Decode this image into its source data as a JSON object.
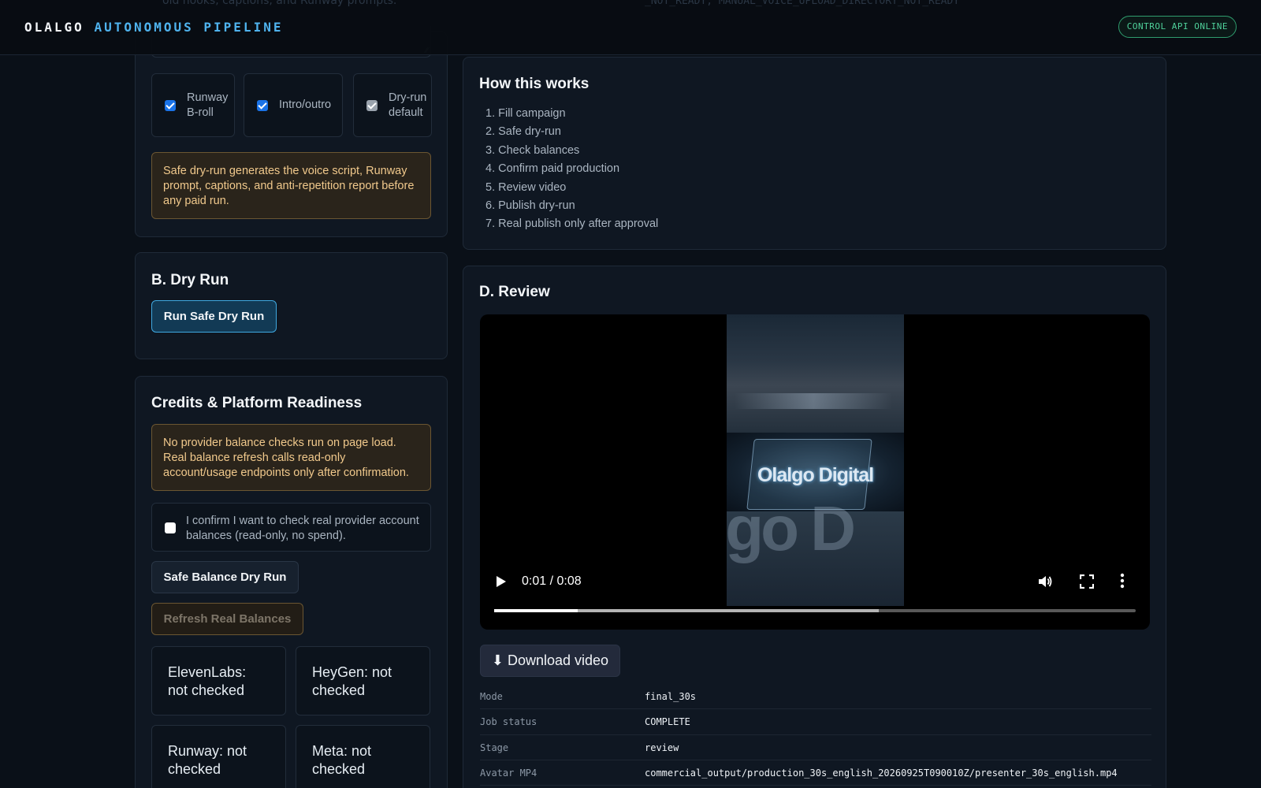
{
  "header": {
    "brand_main": "OLALGO",
    "brand_accent": "AUTONOMOUS PIPELINE",
    "api_status": "CONTROL API ONLINE",
    "bg_text_left": "old hooks, captions, and Runway prompts.",
    "bg_text_right": "_NOT_READY, MANUAL_VOICE_UPLOAD_DIRECTORY_NOT_READY"
  },
  "options": {
    "runway_broll": "Runway B-roll",
    "intro_outro": "Intro/outro",
    "dry_run_default": "Dry-run default",
    "notice": "Safe dry-run generates the voice script, Runway prompt, captions, and anti-repetition report before any paid run."
  },
  "dry_run": {
    "title": "B. Dry Run",
    "button": "Run Safe Dry Run"
  },
  "credits": {
    "title": "Credits & Platform Readiness",
    "notice": "No provider balance checks run on page load. Real balance refresh calls read-only account/usage endpoints only after confirmation.",
    "confirm_label": "I confirm I want to check real provider account balances (read-only, no spend).",
    "safe_button": "Safe Balance Dry Run",
    "refresh_button": "Refresh Real Balances",
    "providers": {
      "elevenlabs": "ElevenLabs: not checked",
      "heygen": "HeyGen: not checked",
      "runway": "Runway: not checked",
      "meta": "Meta: not checked"
    }
  },
  "how": {
    "title": "How this works",
    "steps": [
      "1. Fill campaign",
      "2. Safe dry-run",
      "3. Check balances",
      "4. Confirm paid production",
      "5. Review video",
      "6. Publish dry-run",
      "7. Real publish only after approval"
    ]
  },
  "review": {
    "title": "D. Review",
    "video": {
      "logo_text": "Olalgo Digital",
      "time": "0:01 / 0:08",
      "played_fraction": 0.13,
      "buffered_fraction": 0.6
    },
    "download": "⬇ Download video",
    "details": [
      {
        "k": "Mode",
        "v": "final_30s"
      },
      {
        "k": "Job status",
        "v": "COMPLETE"
      },
      {
        "k": "Stage",
        "v": "review"
      },
      {
        "k": "Avatar MP4",
        "v": "commercial_output/production_30s_english_20260925T090010Z/presenter_30s_english.mp4"
      }
    ]
  }
}
